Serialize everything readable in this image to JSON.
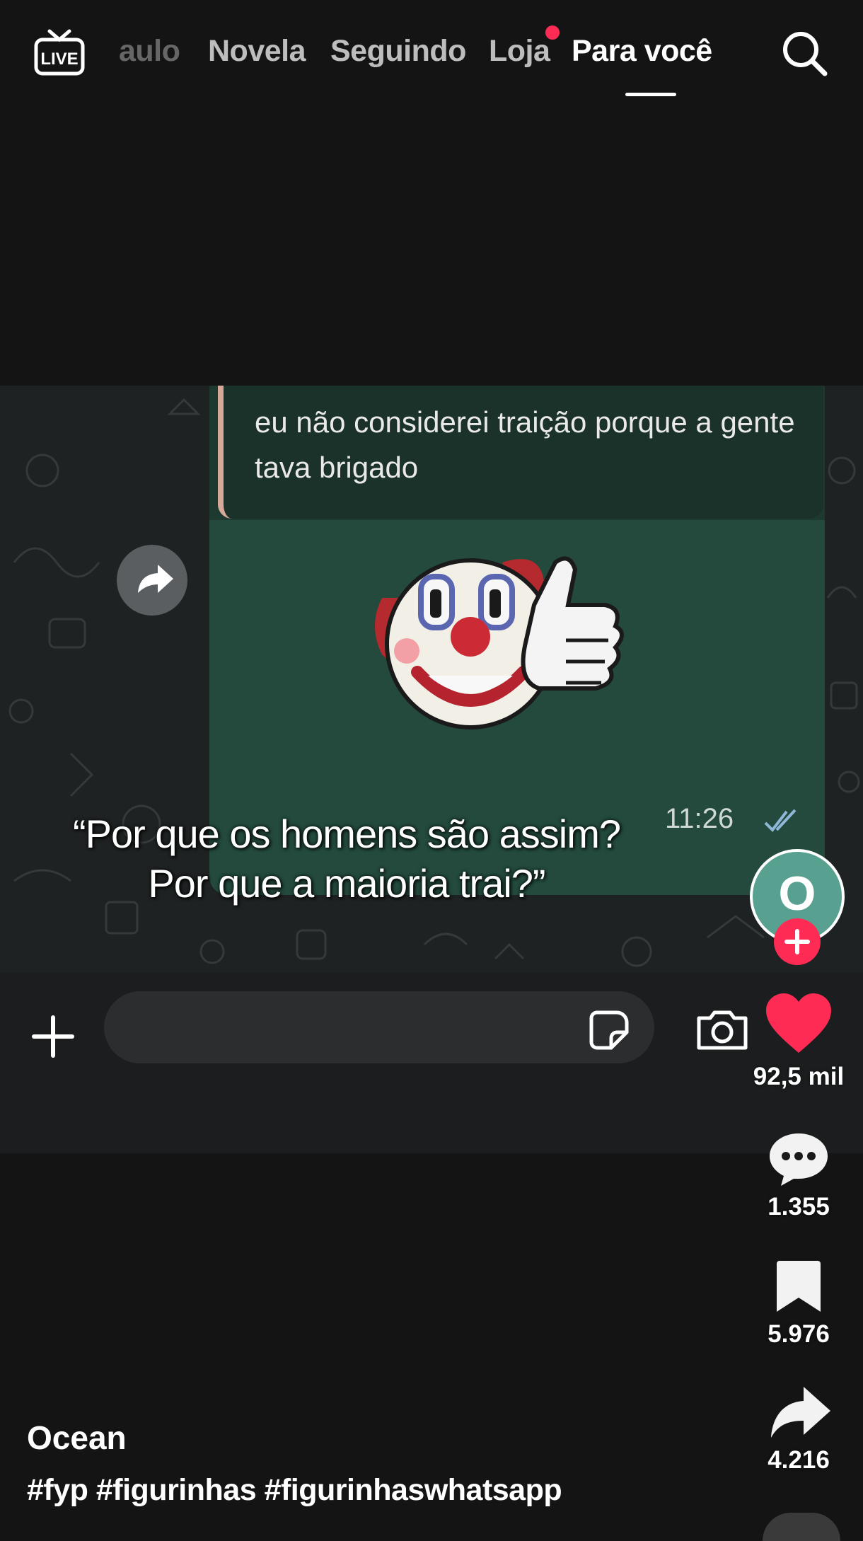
{
  "nav": {
    "live_label": "LIVE",
    "tabs": [
      {
        "label": "aulo",
        "state": "faded"
      },
      {
        "label": "Novela",
        "state": "inactive"
      },
      {
        "label": "Seguindo",
        "state": "inactive"
      },
      {
        "label": "Loja",
        "state": "inactive",
        "badge": "red-dot"
      },
      {
        "label": "Para você",
        "state": "active"
      }
    ],
    "search_icon": "search-icon"
  },
  "video": {
    "quoted_message": "eu não considerei traição porque a gente tava brigado",
    "message_time": "11:26",
    "sticker": "clown-thumbs-up-sticker",
    "bubble_color": "#234a3d"
  },
  "caption": "“Por que os homens são assim? Por que a maioria trai?”",
  "creator": {
    "avatar_letter": "O",
    "name": "Ocean",
    "hashtags": "#fyp #figurinhas #figurinhaswhatsapp"
  },
  "actions": {
    "likes": "92,5 mil",
    "comments": "1.355",
    "bookmarks": "5.976",
    "shares": "4.216"
  },
  "colors": {
    "accent": "#fe2c55",
    "background": "#141414"
  }
}
